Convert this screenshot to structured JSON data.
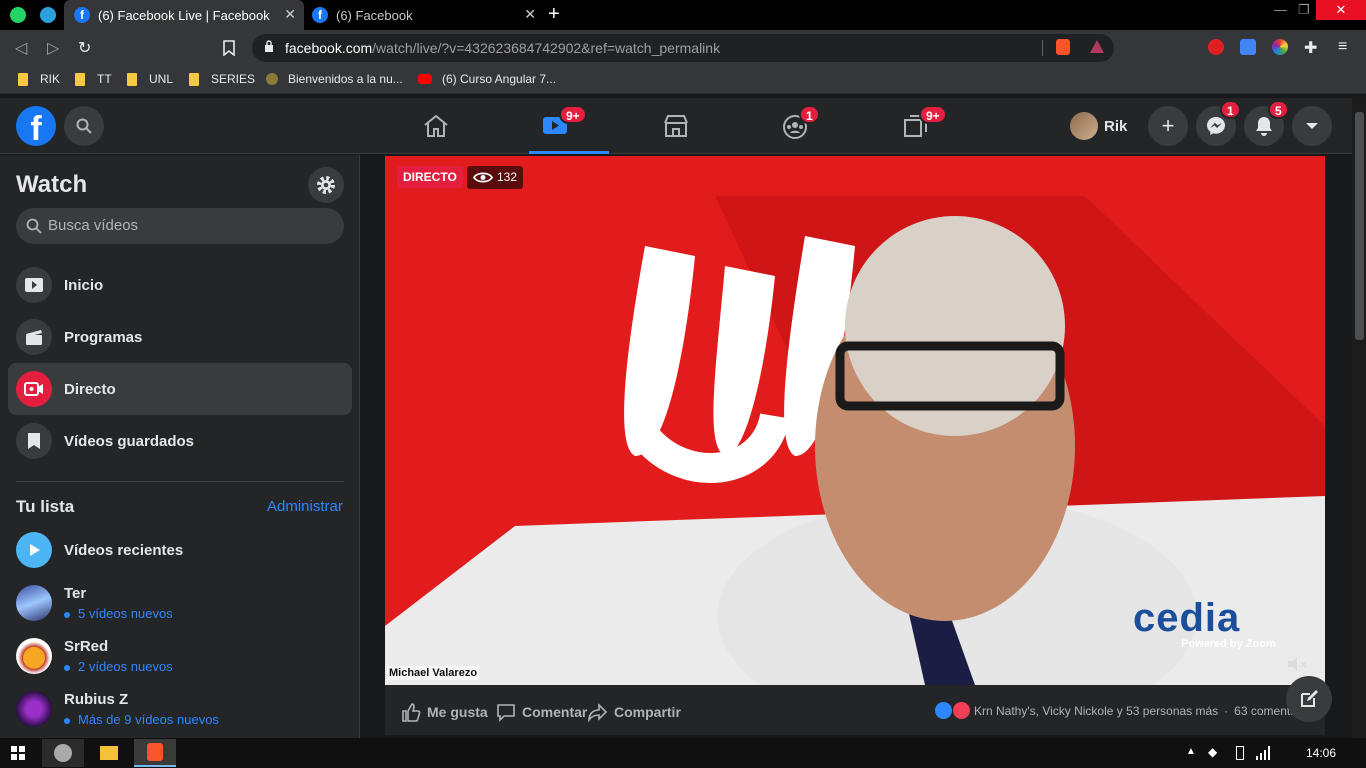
{
  "browser": {
    "tabs": [
      {
        "title": "(6) Facebook Live | Facebook",
        "active": true
      },
      {
        "title": "(6) Facebook",
        "active": false
      }
    ],
    "url_host": "facebook.com",
    "url_path": "/watch/live/?v=432623684742902&ref=watch_permalink",
    "bookmarks": [
      "RIK",
      "TT",
      "UNL",
      "SERIES",
      "Bienvenidos a la nu...",
      "(6) Curso Angular 7..."
    ]
  },
  "fb_header": {
    "watch_badge": "9+",
    "groups_badge": "1",
    "gaming_badge": "9+",
    "profile_name": "Rik",
    "messenger_badge": "1",
    "notifications_badge": "5"
  },
  "sidebar": {
    "title": "Watch",
    "search_placeholder": "Busca vídeos",
    "menu": [
      {
        "label": "Inicio",
        "icon": "play-icon"
      },
      {
        "label": "Programas",
        "icon": "clapperboard-icon"
      },
      {
        "label": "Directo",
        "icon": "live-camera-icon",
        "active": true
      },
      {
        "label": "Vídeos guardados",
        "icon": "bookmark-icon"
      }
    ],
    "list_title": "Tu lista",
    "manage_label": "Administrar",
    "recent_label": "Vídeos recientes",
    "following": [
      {
        "name": "Ter",
        "sub": "5 vídeos nuevos"
      },
      {
        "name": "SrRed",
        "sub": "2 vídeos nuevos"
      },
      {
        "name": "Rubius Z",
        "sub": "Más de 9 vídeos nuevos"
      }
    ]
  },
  "video": {
    "live_label": "DIRECTO",
    "viewers": "132",
    "speaker": "Michael Valarezo",
    "brand": "cedia",
    "brand_sub": "Powered by Zoom"
  },
  "actions": {
    "like": "Me gusta",
    "comment": "Comentar",
    "share": "Compartir",
    "reactions_text": "Krn Nathy's, Vicky Nickole y 53 personas más",
    "separator": "·",
    "comments_count": "63 comenta..."
  },
  "taskbar": {
    "time": "14:06"
  },
  "colors": {
    "fb_blue": "#1877f2",
    "link_blue": "#2d88ff",
    "badge_red": "#e41e3f",
    "video_red": "#e21c1c"
  }
}
